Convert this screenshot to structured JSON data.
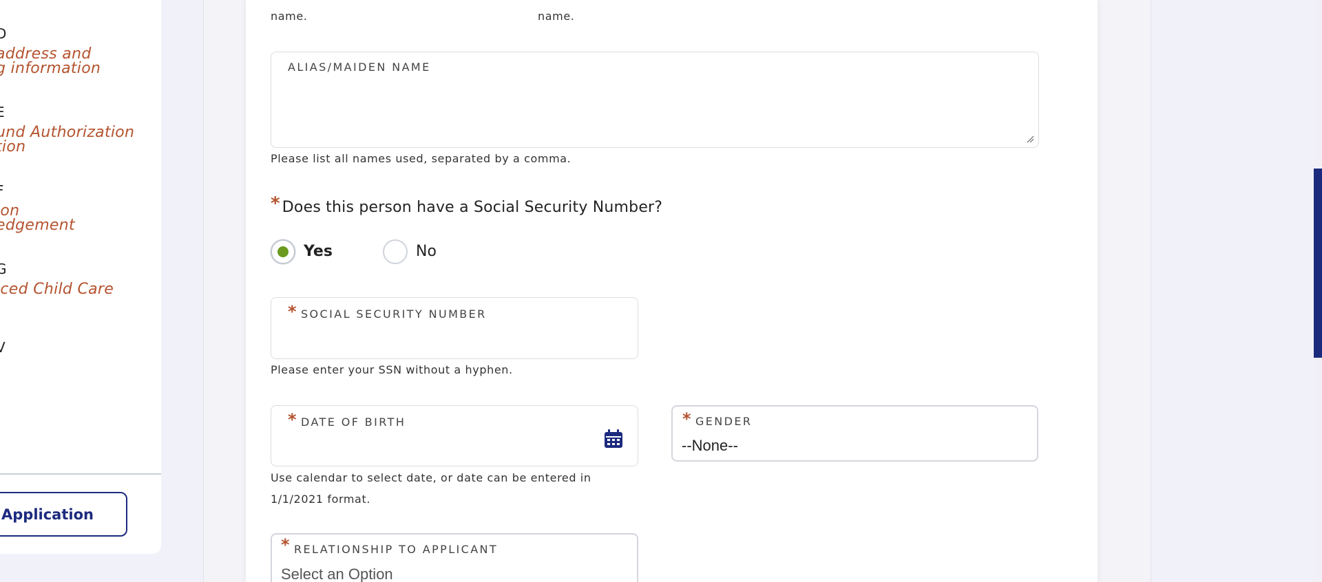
{
  "sidebar": {
    "steps": [
      {
        "num": "D",
        "title": "address and\ng information"
      },
      {
        "num": "E",
        "title": "und Authorization\ntion"
      },
      {
        "num": "F",
        "title": "ion\nedgement"
      },
      {
        "num": "G",
        "title": "iced Child Care"
      },
      {
        "num": "V",
        "title": ""
      }
    ],
    "button_label": "Application"
  },
  "form": {
    "prev_helper_left": "name.",
    "prev_helper_right": "name.",
    "alias": {
      "label": "ALIAS/MAIDEN NAME",
      "value": "",
      "helper": "Please list all names used, separated by a comma."
    },
    "ssn_question": {
      "text": "Does this person have a Social Security Number?",
      "options": [
        {
          "label": "Yes",
          "selected": true
        },
        {
          "label": "No",
          "selected": false
        }
      ]
    },
    "ssn": {
      "label": "SOCIAL SECURITY NUMBER",
      "value": "",
      "helper": "Please enter your SSN without a hyphen."
    },
    "dob": {
      "label": "DATE OF BIRTH",
      "value": "",
      "helper_line1": "Use calendar to select date, or date can be entered in",
      "helper_line2": "1/1/2021 format."
    },
    "gender": {
      "label": "GENDER",
      "value": "--None--"
    },
    "relationship": {
      "label": "RELATIONSHIP TO APPLICANT",
      "value": "Select an Option"
    },
    "required_marker": "*"
  },
  "icons": {
    "calendar": "calendar-icon",
    "resize": "resize-handle-icon"
  },
  "colors": {
    "accent": "#1c2a7e",
    "required": "#b4532f",
    "radio_selected": "#6b9a1f",
    "step_title": "#b4532f",
    "page_bg": "#f1f1f9"
  }
}
